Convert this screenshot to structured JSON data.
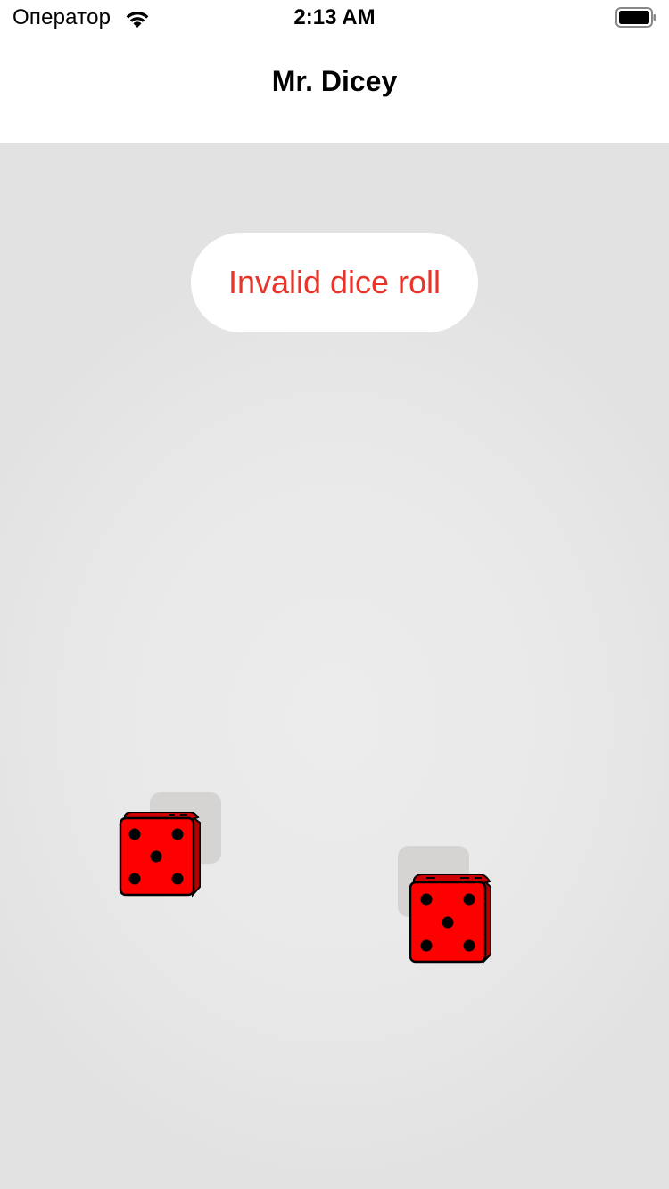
{
  "status_bar": {
    "carrier": "Оператор",
    "time": "2:13 AM"
  },
  "nav": {
    "title": "Mr. Dicey"
  },
  "toast": {
    "message": "Invalid dice roll",
    "color": "#e8342a"
  },
  "dice": [
    {
      "name": "die-left",
      "face": 5,
      "color": "#ff0000"
    },
    {
      "name": "die-right",
      "face": 5,
      "color": "#ff0000"
    }
  ],
  "icons": [
    "wifi-icon",
    "battery-icon"
  ]
}
